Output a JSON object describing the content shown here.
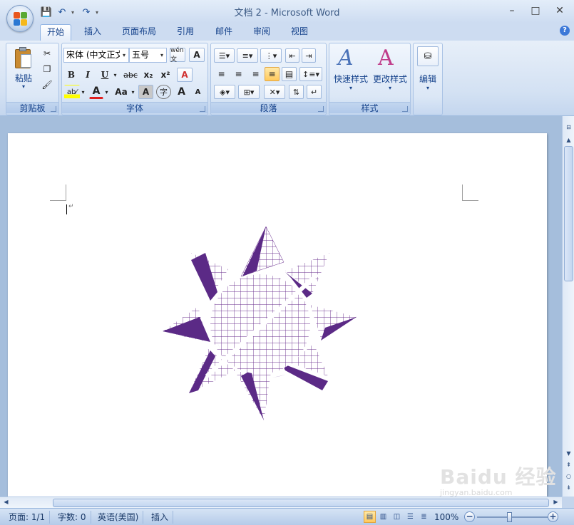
{
  "window": {
    "title": "文档 2 - Microsoft Word",
    "minimize": "–",
    "maximize": "□",
    "close": "✕"
  },
  "qat": {
    "save": "💾",
    "undo": "↶",
    "redo": "↷",
    "customize": "▾"
  },
  "tabs": [
    {
      "label": "开始",
      "active": true
    },
    {
      "label": "插入"
    },
    {
      "label": "页面布局"
    },
    {
      "label": "引用"
    },
    {
      "label": "邮件"
    },
    {
      "label": "审阅"
    },
    {
      "label": "视图"
    }
  ],
  "help": "?",
  "ribbon": {
    "clipboard": {
      "label": "剪贴板",
      "paste": "粘贴",
      "dropdown": "▾"
    },
    "font": {
      "label": "字体",
      "font_name": "宋体 (中文正文)",
      "font_size": "五号",
      "phonetic": "wén文",
      "char_border": "A",
      "bold": "B",
      "italic": "I",
      "underline": "U",
      "strike": "abc",
      "subscript": "x₂",
      "superscript": "x²",
      "clear_format": "A",
      "highlight": "ab⁄",
      "font_color": "A",
      "change_case": "Aa",
      "char_shading": "A",
      "enclose": "字",
      "grow": "A",
      "shrink": "A"
    },
    "paragraph": {
      "label": "段落"
    },
    "styles": {
      "label": "样式",
      "quick_styles": "快速样式",
      "change_styles": "更改样式"
    },
    "editing": {
      "label": "编辑"
    }
  },
  "status": {
    "page": "页面: 1/1",
    "words": "字数: 0",
    "language": "英语(美国)",
    "mode": "插入",
    "zoom": "100%"
  },
  "watermark": {
    "brand": "Baidu 经验",
    "url": "jingyan.baidu.com"
  },
  "colors": {
    "sun_fill": "#5b2a86",
    "sun_grid": "#6a2f8e",
    "accent": "#15428b"
  }
}
